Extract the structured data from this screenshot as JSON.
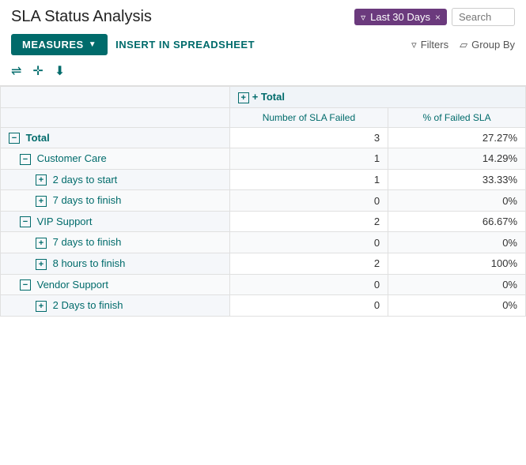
{
  "header": {
    "title": "SLA Status Analysis",
    "filter_tag_label": "Last 30 Days",
    "filter_tag_close": "×",
    "search_placeholder": "Search"
  },
  "toolbar": {
    "measures_label": "MEASURES",
    "insert_label": "INSERT IN SPREADSHEET",
    "filters_label": "Filters",
    "groupby_label": "Group By"
  },
  "icons": {
    "adjust": "⇌",
    "move": "✛",
    "download": "⬇"
  },
  "table": {
    "total_label": "+ Total",
    "columns": [
      {
        "label": "Number of SLA Failed"
      },
      {
        "label": "% of Failed SLA"
      }
    ],
    "rows": [
      {
        "label": "Total",
        "expand": "−",
        "level": 0,
        "values": [
          "3",
          "27.27%"
        ],
        "children": [
          {
            "label": "Customer Care",
            "expand": "−",
            "level": 1,
            "values": [
              "1",
              "14.29%"
            ],
            "children": [
              {
                "label": "2 days to start",
                "expand": "+",
                "level": 2,
                "values": [
                  "1",
                  "33.33%"
                ]
              },
              {
                "label": "7 days to finish",
                "expand": "+",
                "level": 2,
                "values": [
                  "0",
                  "0%"
                ]
              }
            ]
          },
          {
            "label": "VIP Support",
            "expand": "−",
            "level": 1,
            "values": [
              "2",
              "66.67%"
            ],
            "children": [
              {
                "label": "7 days to finish",
                "expand": "+",
                "level": 2,
                "values": [
                  "0",
                  "0%"
                ]
              },
              {
                "label": "8 hours to finish",
                "expand": "+",
                "level": 2,
                "values": [
                  "2",
                  "100%"
                ]
              }
            ]
          },
          {
            "label": "Vendor Support",
            "expand": "−",
            "level": 1,
            "values": [
              "0",
              "0%"
            ],
            "children": [
              {
                "label": "2 Days to finish",
                "expand": "+",
                "level": 2,
                "values": [
                  "0",
                  "0%"
                ]
              }
            ]
          }
        ]
      }
    ]
  }
}
